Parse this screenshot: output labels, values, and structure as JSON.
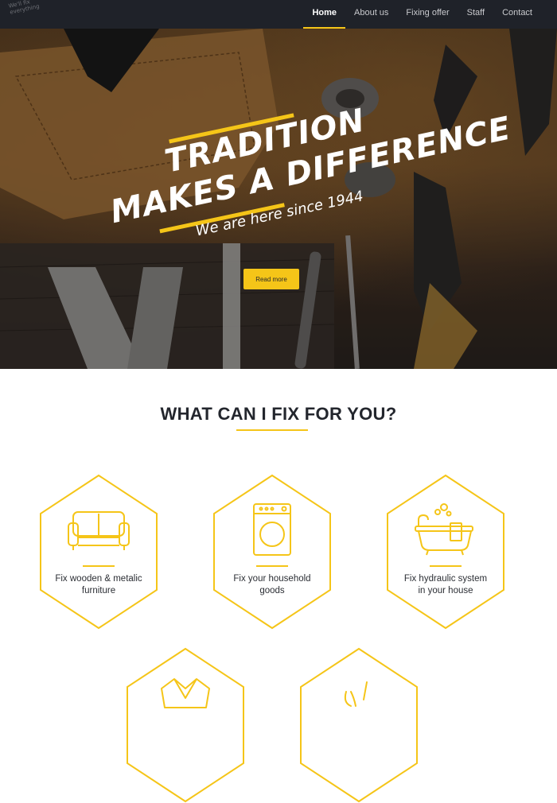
{
  "logo": {
    "line1": "We'll fix",
    "line2": "everything"
  },
  "nav": {
    "items": [
      {
        "label": "Home",
        "active": true
      },
      {
        "label": "About us",
        "active": false
      },
      {
        "label": "Fixing offer",
        "active": false
      },
      {
        "label": "Staff",
        "active": false
      },
      {
        "label": "Contact",
        "active": false
      }
    ]
  },
  "hero": {
    "title_line1": "TRADITION",
    "title_line2": "MAKES A DIFFERENCE",
    "subtitle": "We are here since 1944",
    "button_label": "Read more"
  },
  "services": {
    "heading": "WHAT CAN I FIX FOR YOU?",
    "items": [
      {
        "icon": "sofa-icon",
        "label_line1": "Fix wooden & metalic",
        "label_line2": "furniture"
      },
      {
        "icon": "washing-machine-icon",
        "label_line1": "Fix your household",
        "label_line2": "goods"
      },
      {
        "icon": "bathtub-icon",
        "label_line1": "Fix hydraulic system",
        "label_line2": "in your house"
      },
      {
        "icon": "shirt-icon",
        "label_line1": "",
        "label_line2": ""
      },
      {
        "icon": "tools-icon",
        "label_line1": "",
        "label_line2": ""
      }
    ]
  },
  "colors": {
    "accent": "#f5c518",
    "nav_bg": "#1f2229",
    "heading": "#23262d"
  }
}
